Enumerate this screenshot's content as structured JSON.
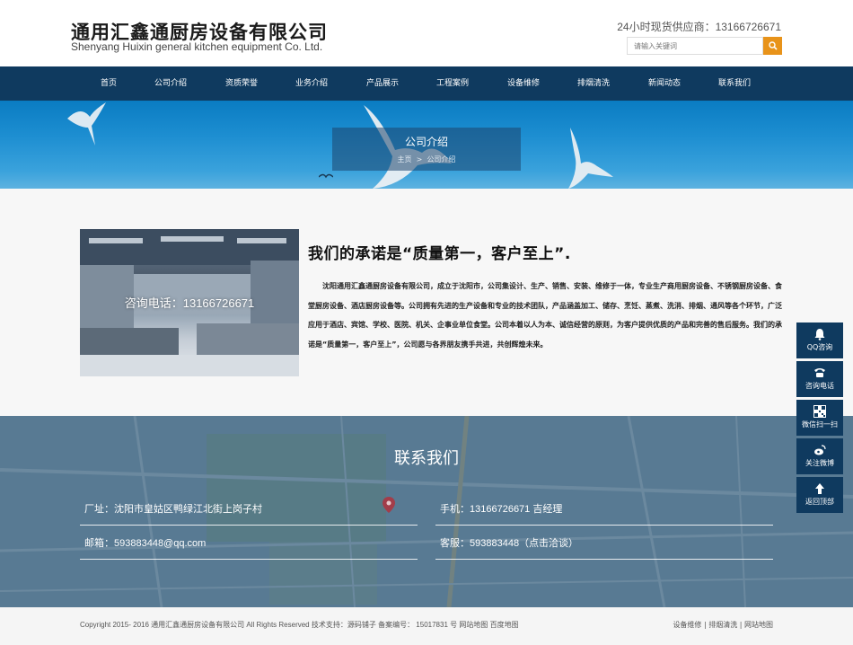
{
  "header": {
    "logo_cn": "通用汇鑫通厨房设备有限公司",
    "logo_en": "Shenyang Huixin general kitchen equipment Co. Ltd.",
    "hotline": "24小时现货供应商：13166726671",
    "search_placeholder": "请输入关键词"
  },
  "nav": {
    "items": [
      "首页",
      "公司介绍",
      "资质荣誉",
      "业务介绍",
      "产品展示",
      "工程案例",
      "设备维修",
      "排烟清洗",
      "新闻动态",
      "联系我们"
    ]
  },
  "banner": {
    "title": "公司介绍",
    "crumb_home": "主页",
    "crumb_sep": ">",
    "crumb_current": "公司介绍"
  },
  "about": {
    "photo_caption": "咨询电话：13166726671",
    "title": "我们的承诺是“质量第一，客户至上”.",
    "text": "沈阳通用汇鑫通厨房设备有限公司，成立于沈阳市，公司集设计、生产、销售、安装、维修于一体，专业生产商用厨房设备、不锈钢厨房设备、食堂厨房设备、酒店厨房设备等。公司拥有先进的生产设备和专业的技术团队，产品涵盖加工、储存、烹饪、蒸煮、洗消、排烟、通风等各个环节，广泛应用于酒店、宾馆、学校、医院、机关、企事业单位食堂。公司本着以人为本、诚信经营的原则，为客户提供优质的产品和完善的售后服务。我们的承诺是“质量第一，客户至上”，公司愿与各界朋友携手共进，共创辉煌未来。"
  },
  "side": {
    "items": [
      {
        "label": "QQ咨询",
        "icon": "bell-icon"
      },
      {
        "label": "咨询电话",
        "icon": "phone-icon"
      },
      {
        "label": "微信扫一扫",
        "icon": "qrcode-icon"
      },
      {
        "label": "关注微博",
        "icon": "weibo-icon"
      },
      {
        "label": "返回顶部",
        "icon": "arrow-up-icon"
      }
    ]
  },
  "contact": {
    "title": "联系我们",
    "address": "厂址：沈阳市皇姑区鸭绿江北街上岗子村",
    "mobile": "手机：13166726671 吉经理",
    "email": "邮箱：593883448@qq.com",
    "service": "客服：593883448（点击洽谈）"
  },
  "footer": {
    "copyright": "Copyright 2015- 2016 通用汇鑫通厨房设备有限公司 All Rights Reserved 技术支持：源码铺子 备案编号： 15017831 号 网站地图 百度地图",
    "links": "设备维修 | 排烟清洗 | 网站地图"
  },
  "colors": {
    "nav_bg": "#0f3a5f",
    "accent": "#e8931a"
  }
}
